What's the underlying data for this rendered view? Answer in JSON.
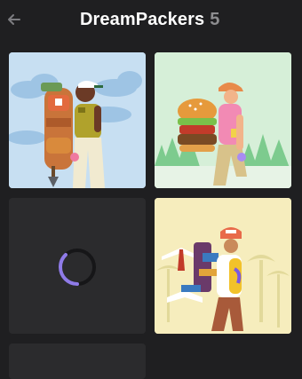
{
  "header": {
    "back_icon": "arrow-left-icon",
    "title": "DreamPackers",
    "count": "5"
  },
  "colors": {
    "background": "#1f1f21",
    "tile_placeholder": "#2b2b2d",
    "spinner_accent": "#8f7be8",
    "count_text": "#8d8d90"
  },
  "tiles": [
    {
      "kind": "illustration",
      "subject": "hiker-with-backpack-clouds"
    },
    {
      "kind": "illustration",
      "subject": "hiker-with-burger-backpack-forest"
    },
    {
      "kind": "loading",
      "icon": "loading-spinner-icon"
    },
    {
      "kind": "illustration",
      "subject": "hiker-with-books-backpack-palms"
    },
    {
      "kind": "loading"
    }
  ]
}
